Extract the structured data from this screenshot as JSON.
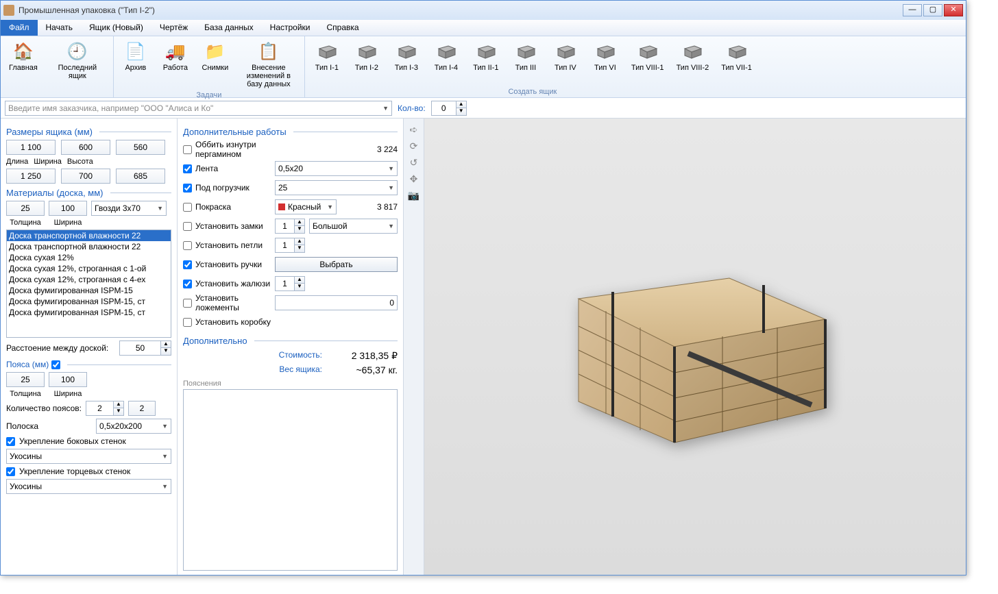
{
  "window": {
    "title": "Промышленная упаковка (\"Тип I-2\")"
  },
  "menu": [
    "Файл",
    "Начать",
    "Ящик (Новый)",
    "Чертёж",
    "База данных",
    "Настройки",
    "Справка"
  ],
  "menu_active": 0,
  "ribbon": {
    "groups": [
      {
        "label": "",
        "items": [
          {
            "icon": "🏠",
            "label": "Главная"
          },
          {
            "icon": "🕘",
            "label": "Последний ящик"
          }
        ]
      },
      {
        "label": "Задачи",
        "items": [
          {
            "icon": "📄",
            "label": "Архив"
          },
          {
            "icon": "🚚",
            "label": "Работа"
          },
          {
            "icon": "📁",
            "label": "Снимки"
          },
          {
            "icon": "📋",
            "label": "Внесение изменений в базу данных"
          }
        ]
      },
      {
        "label": "Создать ящик",
        "items": [
          {
            "icon": "box",
            "label": "Тип I-1"
          },
          {
            "icon": "box",
            "label": "Тип I-2"
          },
          {
            "icon": "box",
            "label": "Тип I-3"
          },
          {
            "icon": "box",
            "label": "Тип I-4"
          },
          {
            "icon": "box",
            "label": "Тип II-1"
          },
          {
            "icon": "box",
            "label": "Тип III"
          },
          {
            "icon": "box",
            "label": "Тип IV"
          },
          {
            "icon": "box",
            "label": "Тип VI"
          },
          {
            "icon": "box",
            "label": "Тип VIII-1"
          },
          {
            "icon": "box",
            "label": "Тип VIII-2"
          },
          {
            "icon": "box",
            "label": "Тип VII-1"
          }
        ]
      }
    ]
  },
  "quick": {
    "customer_placeholder": "Введите имя заказчика, например \"ООО \"Алиса и Ко\"",
    "qty_label": "Кол-во:",
    "qty": "0"
  },
  "left": {
    "dims_title": "Размеры ящика (мм)",
    "dims": [
      {
        "v": "1 100",
        "l": "Длина"
      },
      {
        "v": "600",
        "l": "Ширина"
      },
      {
        "v": "560",
        "l": "Высота"
      }
    ],
    "dims2": [
      "1 250",
      "700",
      "685"
    ],
    "materials_title": "Материалы (доска, мм)",
    "thickness": "25",
    "width": "100",
    "nails": "Гвозди 3x70",
    "thickness_l": "Толщина",
    "width_l": "Ширина",
    "plank_list": [
      "Доска транспортной влажности 22",
      "Доска транспортной влажности 22",
      "Доска сухая 12%",
      "Доска сухая 12%, строганная с 1-ой",
      "Доска сухая 12%, строганная с 4-ех",
      "Доска фумигированная ISPM-15",
      "Доска фумигированная ISPM-15, ст",
      "Доска фумигированная ISPM-15, ст"
    ],
    "plank_spacing_l": "Расстоение между доской:",
    "plank_spacing": "50",
    "belts_title": "Пояса (мм)",
    "belt_t": "25",
    "belt_w": "100",
    "belt_count_l": "Количество поясов:",
    "belt_c1": "2",
    "belt_c2": "2",
    "strip_l": "Полоска",
    "strip": "0,5x20x200",
    "reinforce_side": "Укрепление боковых стенок",
    "reinforce_side_v": "Укосины",
    "reinforce_end": "Укрепление торцевых стенок",
    "reinforce_end_v": "Укосины"
  },
  "mid": {
    "works_title": "Дополнительные работы",
    "rows": [
      {
        "chk": false,
        "label": "Оббить изнутри пергамином",
        "right": "3 224"
      },
      {
        "chk": true,
        "label": "Лента",
        "select": "0,5x20"
      },
      {
        "chk": true,
        "label": "Под погрузчик",
        "select": "25"
      },
      {
        "chk": false,
        "label": "Покраска",
        "color": "Красный",
        "right": "3 817"
      },
      {
        "chk": false,
        "label": "Установить замки",
        "spin": "1",
        "select2": "Большой"
      },
      {
        "chk": false,
        "label": "Установить петли",
        "spin": "1"
      },
      {
        "chk": true,
        "label": "Установить ручки",
        "btn": "Выбрать"
      },
      {
        "chk": true,
        "label": "Установить жалюзи",
        "spin": "1"
      },
      {
        "chk": false,
        "label": "Установить ложементы",
        "num": "0"
      },
      {
        "chk": false,
        "label": "Установить коробку"
      }
    ],
    "extra_title": "Дополнительно",
    "cost_l": "Стоимость:",
    "cost": "2 318,35 ₽",
    "weight_l": "Вес ящика:",
    "weight": "~65,37 кг.",
    "notes_l": "Пояснения"
  }
}
